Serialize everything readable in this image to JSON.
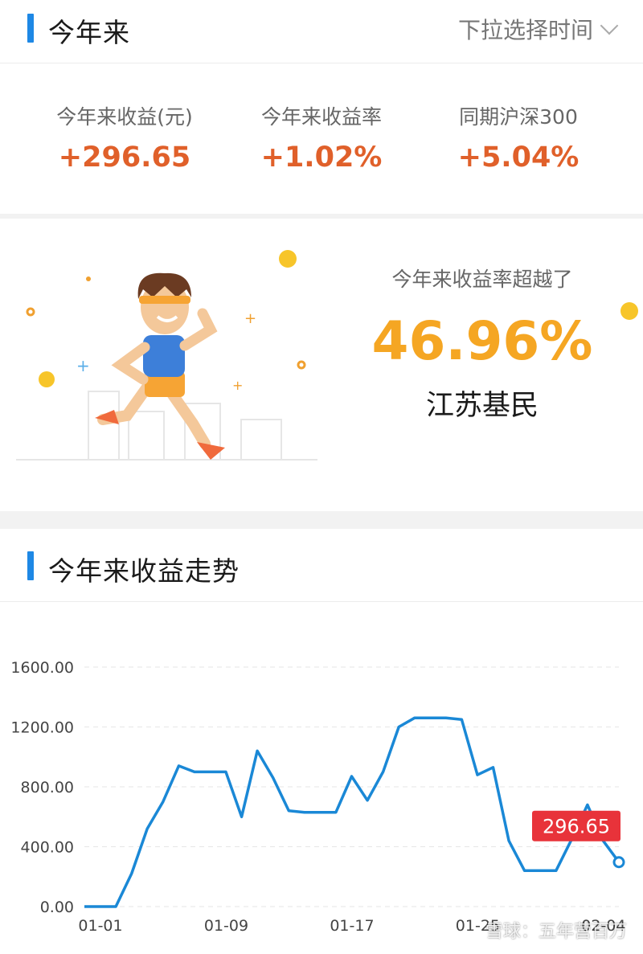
{
  "header": {
    "title": "今年来",
    "dropdown_label": "下拉选择时间",
    "dropdown_icon": "chevron-down-icon"
  },
  "stats": [
    {
      "label": "今年来收益(元)",
      "value": "+296.65"
    },
    {
      "label": "今年来收益率",
      "value": "+1.02%"
    },
    {
      "label": "同期沪深300",
      "value": "+5.04%"
    }
  ],
  "beat": {
    "label": "今年来收益率超越了",
    "percent": "46.96%",
    "region": "江苏基民"
  },
  "trend": {
    "title": "今年来收益走势",
    "badge_value": "296.65"
  },
  "colors": {
    "accent": "#1e88e5",
    "positive": "#e0602a",
    "beat": "#f5a623",
    "line": "#1a88d6",
    "badge": "#e8333a"
  },
  "chart_data": {
    "type": "line",
    "x_ticks": [
      "01-01",
      "01-09",
      "01-17",
      "01-25",
      "02-04"
    ],
    "y_ticks": [
      "0.00",
      "400.00",
      "800.00",
      "1200.00",
      "1600.00"
    ],
    "ylim": [
      0,
      1600
    ],
    "grid": true,
    "values": [
      0,
      0,
      0,
      220,
      520,
      700,
      940,
      900,
      900,
      900,
      600,
      1040,
      860,
      640,
      630,
      630,
      630,
      870,
      710,
      900,
      1200,
      1260,
      1260,
      1260,
      1250,
      880,
      930,
      440,
      240,
      240,
      240,
      450,
      680,
      440,
      296.65
    ],
    "last_value_label": "296.65"
  },
  "watermark": "雪球：五年营百万"
}
